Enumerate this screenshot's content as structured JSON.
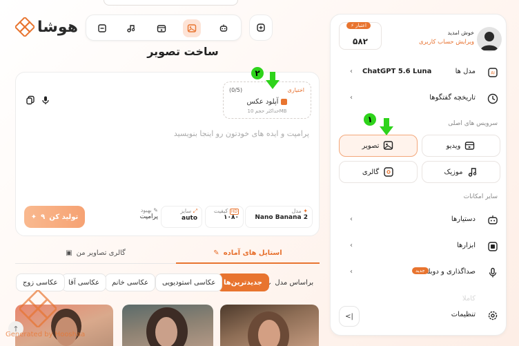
{
  "app": {
    "logo_text": "هوشا"
  },
  "toolbar": {
    "items": [
      "chat-icon",
      "image-gen-icon",
      "video-icon",
      "magic-icon",
      "file-icon"
    ],
    "extra": "add-icon"
  },
  "page": {
    "title": "ساخت تصویر"
  },
  "prompt": {
    "placeholder": "پرامپت و ایده های خودتون رو اینجا بنویسید",
    "upload": {
      "optional": "اختیاری",
      "count": "(0/5)",
      "title": "آپلود عکس",
      "hint": "حداکثر حجم 10MB"
    },
    "options": {
      "model_label": "مدل",
      "model_value": "Nano Banana 2",
      "quality_label": "کیفیت",
      "quality_value": "۱۰۸۰",
      "size_label": "سایز",
      "size_value": "auto",
      "enhance_label": "بهبود",
      "enhance_value": "پرامپت"
    },
    "generate_label": "تولید کن",
    "generate_cost": "۹"
  },
  "tabs": {
    "styles": "استایل های آماده",
    "gallery": "گالری تصاویر من"
  },
  "filters": {
    "by_model": "براساس مدل",
    "chips": [
      "جدیدترین‌ها",
      "عکاسی استودیویی",
      "عکاسی خانم",
      "عکاسی آقا",
      "عکاسی زوج"
    ]
  },
  "watermark": "Generated by Hooshaa",
  "sidebar": {
    "welcome": "خوش امدید",
    "edit_account": "ویرایش حساب کاربری",
    "credit_label": "اعتبار",
    "credit_value": "۵۸۲",
    "models_label": "مدل ها",
    "models_value": "ChatGPT 5.6 Luna",
    "history_label": "تاریخچه گفتگوها",
    "main_services": "سرویس های اصلی",
    "services": {
      "video": "ویدیو",
      "image": "تصویر",
      "music": "موزیک",
      "gallery": "گالری"
    },
    "other_features": "سایر امکانات",
    "assistants": "دستیارها",
    "tools": "ابزارها",
    "voice": "صداگذاری و دوبله",
    "new_badge": "جدید",
    "faded_item": "کاملا",
    "settings": "تنظیمات",
    "collapse": "<|"
  },
  "annotations": {
    "step1": "۱",
    "step2": "۲"
  },
  "colors": {
    "accent": "#e8742f",
    "annotation_green": "#2ed31b"
  }
}
